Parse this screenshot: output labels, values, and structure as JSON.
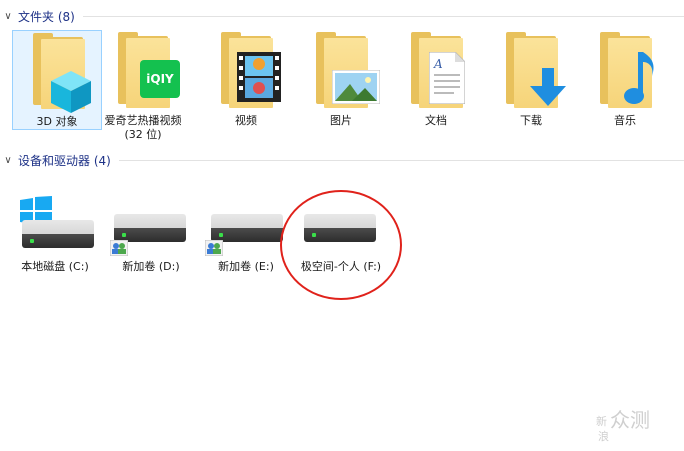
{
  "groups": {
    "folders": {
      "title": "文件夹 (8)"
    },
    "devices": {
      "title": "设备和驱动器 (4)"
    }
  },
  "folders": [
    {
      "label": "3D 对象",
      "icon": "3d-cube-icon",
      "selected": true
    },
    {
      "label": "爱奇艺热播视频",
      "label2": "(32 位)",
      "icon": "iqiyi-icon"
    },
    {
      "label": "视频",
      "icon": "film-strip-icon"
    },
    {
      "label": "图片",
      "icon": "landscape-picture-icon"
    },
    {
      "label": "文档",
      "icon": "document-icon"
    },
    {
      "label": "下载",
      "icon": "download-arrow-icon"
    },
    {
      "label": "音乐",
      "icon": "music-note-icon"
    }
  ],
  "drives": [
    {
      "label": "本地磁盘 (C:)",
      "icon": "windows-logo-icon"
    },
    {
      "label": "新加卷 (D:)",
      "icon": "shared-users-icon"
    },
    {
      "label": "新加卷 (E:)",
      "icon": "shared-users-icon"
    },
    {
      "label": "极空间-个人 (F:)"
    }
  ],
  "iqiyi_text": "iQIY",
  "watermark": {
    "big": "众测",
    "small_top": "新",
    "small_bottom": "浪"
  },
  "colors": {
    "group_title": "#1e3287",
    "annotation": "#e0221b",
    "folder": "#f6d479"
  }
}
